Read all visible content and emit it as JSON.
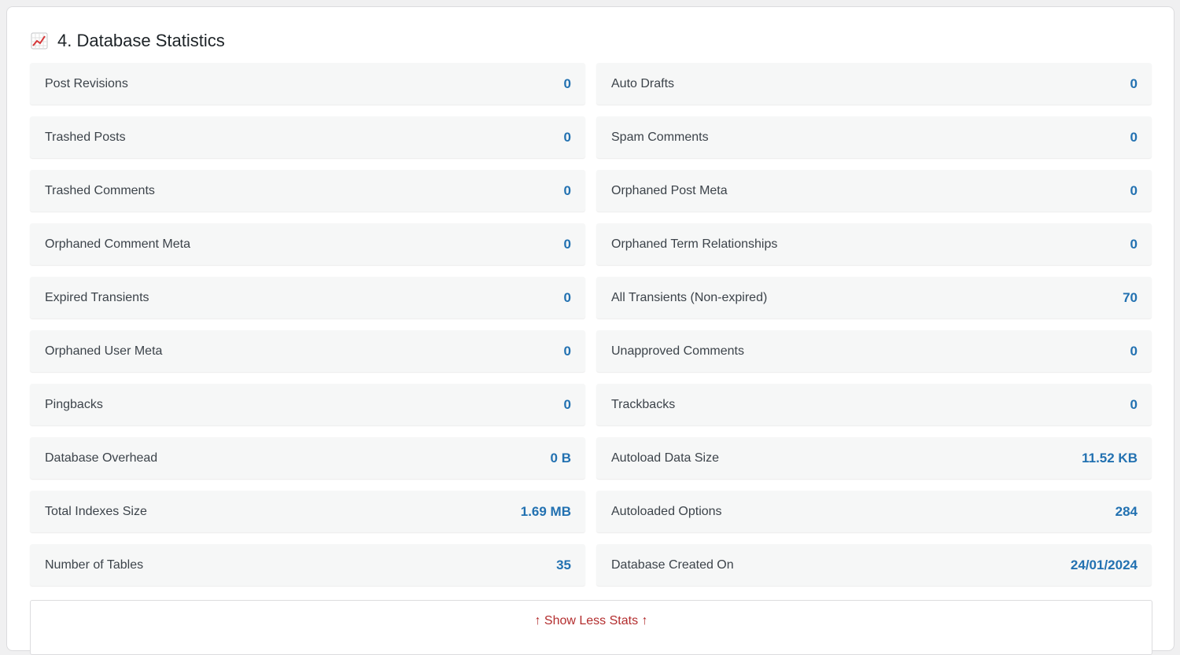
{
  "section": {
    "icon": "chart-increasing-icon",
    "title": "4. Database Statistics"
  },
  "stats": [
    {
      "label": "Post Revisions",
      "value": "0"
    },
    {
      "label": "Auto Drafts",
      "value": "0"
    },
    {
      "label": "Trashed Posts",
      "value": "0"
    },
    {
      "label": "Spam Comments",
      "value": "0"
    },
    {
      "label": "Trashed Comments",
      "value": "0"
    },
    {
      "label": "Orphaned Post Meta",
      "value": "0"
    },
    {
      "label": "Orphaned Comment Meta",
      "value": "0"
    },
    {
      "label": "Orphaned Term Relationships",
      "value": "0"
    },
    {
      "label": "Expired Transients",
      "value": "0"
    },
    {
      "label": "All Transients (Non-expired)",
      "value": "70"
    },
    {
      "label": "Orphaned User Meta",
      "value": "0"
    },
    {
      "label": "Unapproved Comments",
      "value": "0"
    },
    {
      "label": "Pingbacks",
      "value": "0"
    },
    {
      "label": "Trackbacks",
      "value": "0"
    },
    {
      "label": "Database Overhead",
      "value": "0 B"
    },
    {
      "label": "Autoload Data Size",
      "value": "11.52 KB"
    },
    {
      "label": "Total Indexes Size",
      "value": "1.69 MB"
    },
    {
      "label": "Autoloaded Options",
      "value": "284"
    },
    {
      "label": "Number of Tables",
      "value": "35"
    },
    {
      "label": "Database Created On",
      "value": "24/01/2024"
    }
  ],
  "toggle": {
    "label": "↑ Show Less Stats ↑"
  },
  "colors": {
    "value": "#2271b1",
    "toggle": "#b32d2e",
    "card_bg": "#f6f7f7"
  }
}
